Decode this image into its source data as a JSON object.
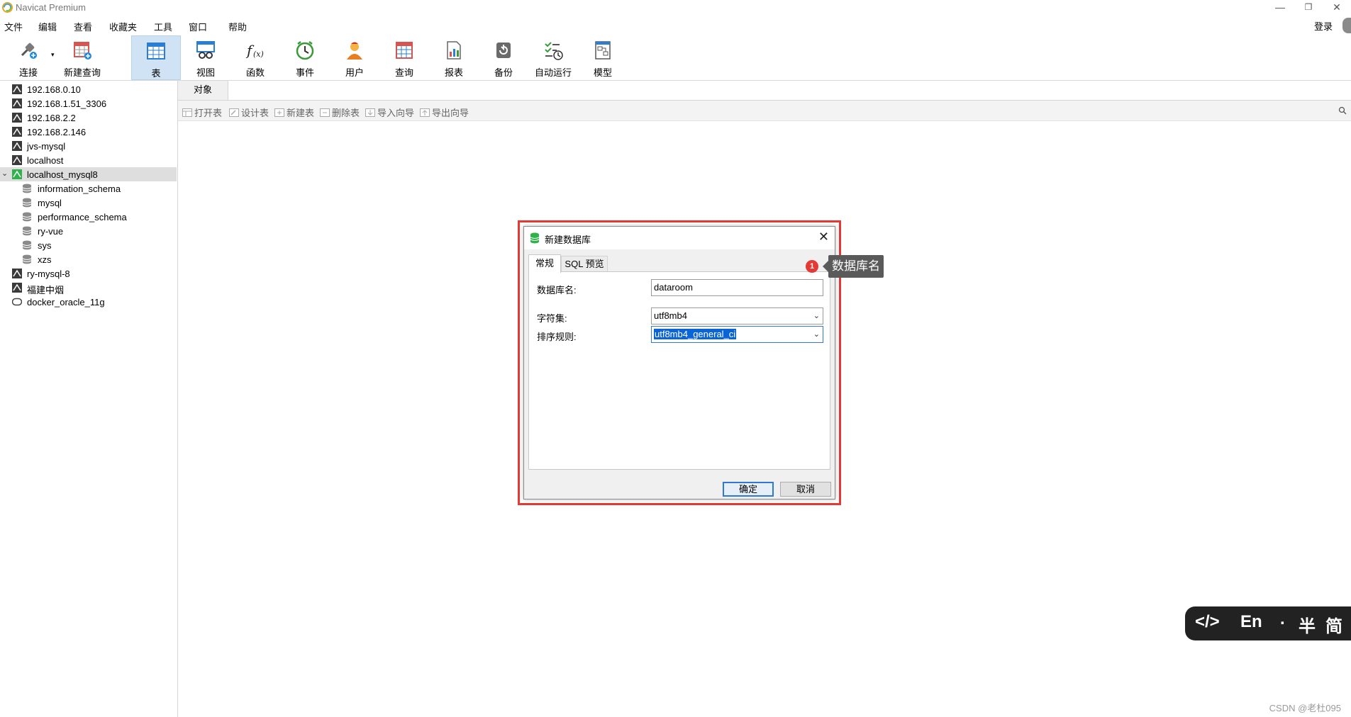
{
  "window": {
    "title": "Navicat Premium",
    "controls": {
      "minimize": "—",
      "restore": "❐",
      "close": "✕"
    }
  },
  "menu": [
    "文件",
    "编辑",
    "查看",
    "收藏夹",
    "工具",
    "窗口",
    "帮助"
  ],
  "login_label": "登录",
  "toolbar": [
    {
      "label": "连接",
      "icon": "connection-icon"
    },
    {
      "label": "新建查询",
      "icon": "new-query-icon"
    },
    {
      "label": "表",
      "icon": "table-icon",
      "active": true
    },
    {
      "label": "视图",
      "icon": "view-icon"
    },
    {
      "label": "函数",
      "icon": "function-icon"
    },
    {
      "label": "事件",
      "icon": "event-clock-icon"
    },
    {
      "label": "用户",
      "icon": "user-icon"
    },
    {
      "label": "查询",
      "icon": "query-icon"
    },
    {
      "label": "报表",
      "icon": "report-icon"
    },
    {
      "label": "备份",
      "icon": "backup-icon"
    },
    {
      "label": "自动运行",
      "icon": "automation-icon"
    },
    {
      "label": "模型",
      "icon": "model-icon"
    }
  ],
  "sidebar": {
    "connections": [
      {
        "label": "192.168.0.10",
        "type": "mysql-connection"
      },
      {
        "label": "192.168.1.51_3306",
        "type": "mysql-connection"
      },
      {
        "label": "192.168.2.2",
        "type": "mysql-connection"
      },
      {
        "label": "192.168.2.146",
        "type": "mysql-connection"
      },
      {
        "label": "jvs-mysql",
        "type": "mysql-connection"
      },
      {
        "label": "localhost",
        "type": "mysql-connection"
      },
      {
        "label": "localhost_mysql8",
        "type": "mysql-connection-open",
        "expanded": true,
        "selected": true
      },
      {
        "label": "information_schema",
        "type": "database",
        "child": true
      },
      {
        "label": "mysql",
        "type": "database",
        "child": true
      },
      {
        "label": "performance_schema",
        "type": "database",
        "child": true
      },
      {
        "label": "ry-vue",
        "type": "database",
        "child": true
      },
      {
        "label": "sys",
        "type": "database",
        "child": true
      },
      {
        "label": "xzs",
        "type": "database",
        "child": true
      },
      {
        "label": "ry-mysql-8",
        "type": "mysql-connection"
      },
      {
        "label": "福建中烟",
        "type": "mysql-connection"
      },
      {
        "label": "docker_oracle_11g",
        "type": "oracle-connection"
      }
    ]
  },
  "main": {
    "tab_label": "对象",
    "object_toolbar": [
      "打开表",
      "设计表",
      "新建表",
      "删除表",
      "导入向导",
      "导出向导"
    ]
  },
  "dialog": {
    "title": "新建数据库",
    "tabs": [
      "常规",
      "SQL 预览"
    ],
    "fields": {
      "db_name": {
        "label": "数据库名:",
        "value": "dataroom"
      },
      "charset": {
        "label": "字符集:",
        "value": "utf8mb4"
      },
      "collation": {
        "label": "排序规则:",
        "value": "utf8mb4_general_ci"
      }
    },
    "ok_label": "确定",
    "cancel_label": "取消"
  },
  "annotation": {
    "badge": "1",
    "text": "数据库名",
    "color": "#e53935"
  },
  "ime": {
    "code": "</>",
    "lang": "En",
    "dot": ".",
    "width": "半",
    "script": "简"
  },
  "watermark": "CSDN @老杜095"
}
